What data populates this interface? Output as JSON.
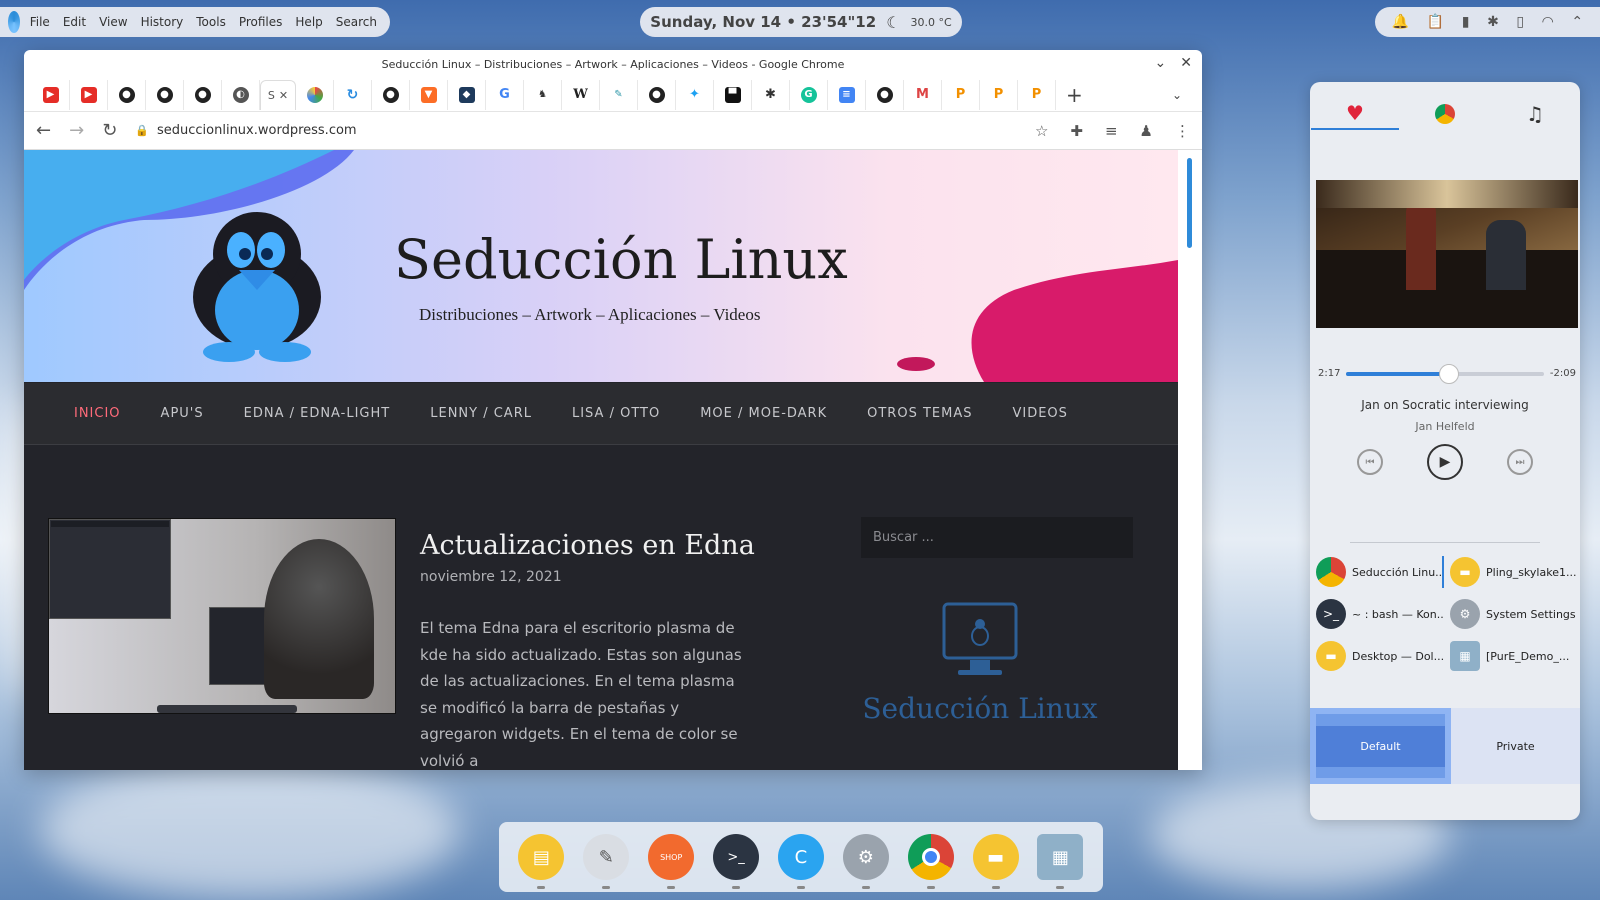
{
  "menubar": {
    "items": [
      "File",
      "Edit",
      "View",
      "History",
      "Tools",
      "Profiles",
      "Help",
      "Search"
    ]
  },
  "clock": {
    "datetime": "Sunday, Nov 14 • 23'54\"12",
    "temperature": "30.0 °C"
  },
  "browser": {
    "title": "Seducción Linux – Distribuciones – Artwork – Aplicaciones – Videos - Google Chrome",
    "active_tab_label": "S",
    "url": "seduccionlinux.wordpress.com",
    "tab_icons": [
      "youtube",
      "youtube",
      "github",
      "github",
      "github",
      "circle",
      "active",
      "ring",
      "sync",
      "github",
      "gitlab",
      "shield",
      "google",
      "badge",
      "wikipedia",
      "pen",
      "github",
      "twitter",
      "terminal",
      "settings",
      "grammarly",
      "docs",
      "github",
      "gmail",
      "pling",
      "pling",
      "pling"
    ]
  },
  "site": {
    "title": "Seducción Linux",
    "tagline": "Distribuciones – Artwork – Aplicaciones – Videos",
    "nav": [
      "INICIO",
      "APU'S",
      "EDNA / EDNA-LIGHT",
      "LENNY / CARL",
      "LISA / OTTO",
      "MOE / MOE-DARK",
      "OTROS TEMAS",
      "VIDEOS"
    ],
    "post": {
      "title": "Actualizaciones en Edna",
      "date": "noviembre 12, 2021",
      "excerpt": "El tema Edna para el escritorio plasma de kde ha sido actualizado. Estas son algunas de las actualizaciones. En el tema plasma se modificó la barra de pestañas y agregaron widgets. En el tema de color se volvió a"
    },
    "search_placeholder": "Buscar ...",
    "widget_brand": "Seducción Linux"
  },
  "player": {
    "elapsed": "2:17",
    "remaining": "-2:09",
    "progress_fraction": 0.52,
    "track_title": "Jan on Socratic interviewing",
    "artist": "Jan Helfeld",
    "tasks": [
      {
        "label": "Seducción Linu...",
        "icon": "chrome-icon",
        "color": "#e04b3a"
      },
      {
        "label": "Pling_skylake1...",
        "icon": "folder-icon",
        "color": "#f5c431"
      },
      {
        "label": "~ : bash — Kon...",
        "icon": "terminal-icon",
        "color": "#2b3442"
      },
      {
        "label": "System Settings",
        "icon": "settings-icon",
        "color": "#9aa3ad"
      },
      {
        "label": "Desktop — Dol...",
        "icon": "folder-icon",
        "color": "#f5c431"
      },
      {
        "label": "[PurE_Demo_...",
        "icon": "image-icon",
        "color": "#8fb0c8"
      }
    ],
    "profiles": {
      "default": "Default",
      "private": "Private"
    }
  },
  "dock": [
    {
      "icon": "notes-icon",
      "color": "#f5c431"
    },
    {
      "icon": "text-editor-icon",
      "color": "#d9dde3"
    },
    {
      "icon": "shop-icon",
      "color": "#f26a2e"
    },
    {
      "icon": "terminal-icon",
      "color": "#2b3442"
    },
    {
      "icon": "browser-c-icon",
      "color": "#2aa4f0"
    },
    {
      "icon": "settings-icon",
      "color": "#9aa3ad"
    },
    {
      "icon": "chrome-icon",
      "color": "#e04b3a"
    },
    {
      "icon": "folder-icon",
      "color": "#f5c431"
    },
    {
      "icon": "desktop-icon",
      "color": "#8fb0c8"
    }
  ],
  "dock_shop_label": "SHOP",
  "colors": {
    "accent": "#2f7fd8",
    "nav_active": "#ff6b7a",
    "site_dark": "#23242a",
    "brand_blue": "#2d5f96"
  }
}
